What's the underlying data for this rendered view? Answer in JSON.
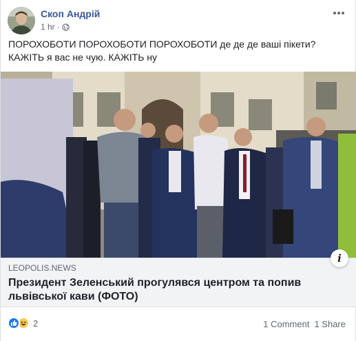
{
  "post": {
    "author": "Скоп Андрій",
    "time": "1 hr",
    "separator": "·",
    "privacy_icon": "globe-icon",
    "more_icon": "more-options-icon",
    "text_line1": "ПОРОХОБОТИ ПОРОХОБОТИ ПОРОХОБОТИ де де де ваші пікети?",
    "text_line2": "КАЖІТЬ я вас не чую. КАЖІТЬ ну"
  },
  "link_preview": {
    "domain": "LEOPOLIS.NEWS",
    "headline": "Президент Зеленський прогулявся центром та попив львівської кави (ФОТО)",
    "info_icon_glyph": "i"
  },
  "footer": {
    "reaction_icons": [
      "like-icon",
      "haha-icon"
    ],
    "reaction_count": "2",
    "comments": "1 Comment",
    "shares": "1 Share"
  },
  "colors": {
    "author_link": "#385898",
    "meta_text": "#616770",
    "like_blue": "#1877f2",
    "haha_yellow": "#f7c94f",
    "link_box_bg": "#f2f3f5"
  }
}
